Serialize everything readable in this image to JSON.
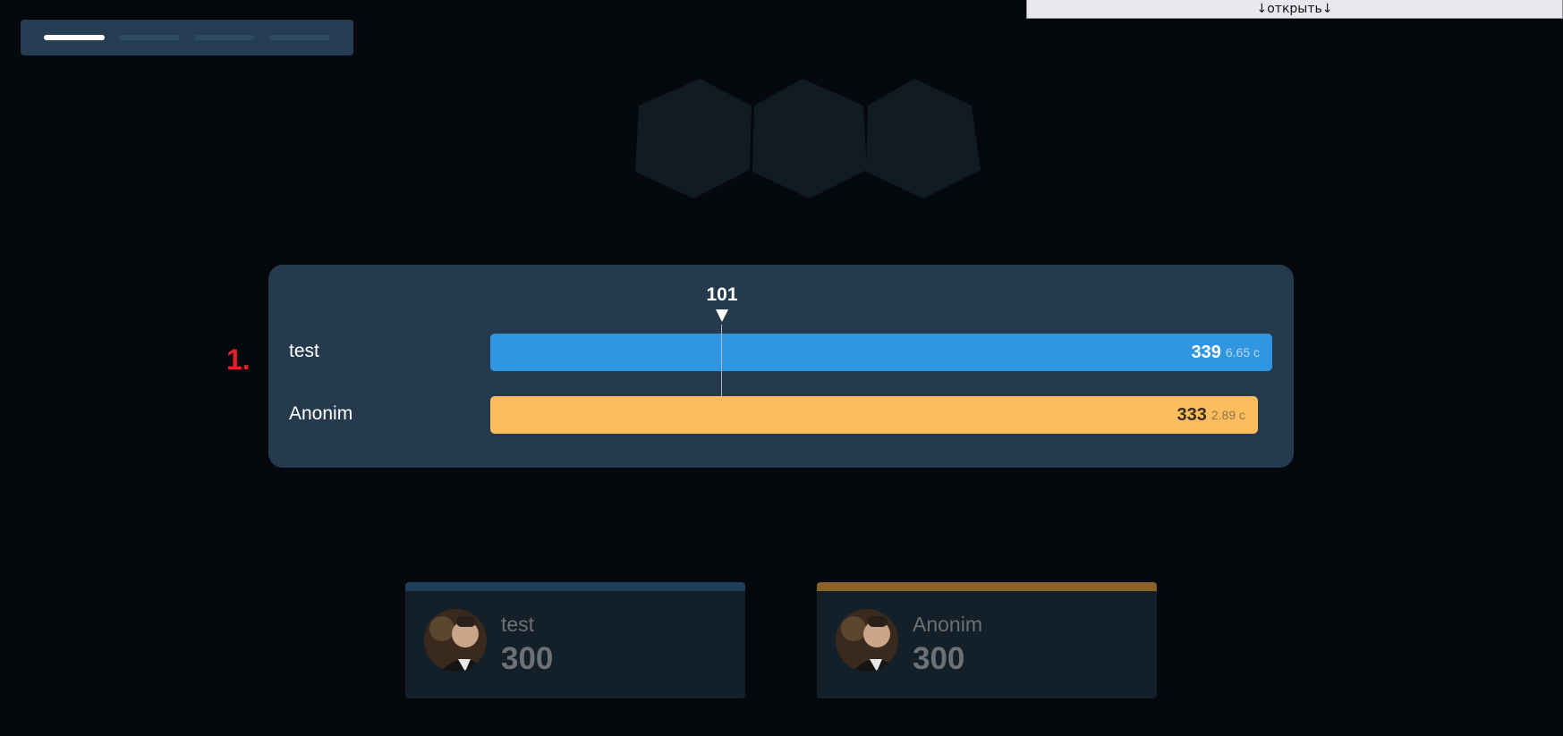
{
  "toggle": {
    "label": "↓открыть↓"
  },
  "steps": {
    "active": 1,
    "count": 4
  },
  "leaderboard": {
    "rank": "1.",
    "marker": {
      "value": "101"
    },
    "rows": [
      {
        "name": "test",
        "score": "339",
        "time": "6.65 с",
        "color": "#3196e2"
      },
      {
        "name": "Anonim",
        "score": "333",
        "time": "2.89 с",
        "color": "#fdbd5c"
      }
    ]
  },
  "players": [
    {
      "name": "test",
      "score": "300",
      "accent": "#1f3f58",
      "avatar_icon": "avatar-photo"
    },
    {
      "name": "Anonim",
      "score": "300",
      "accent": "#8b6326",
      "avatar_icon": "avatar-photo"
    }
  ],
  "colors": {
    "background": "#05090d",
    "panel": "#253a4c",
    "rank": "#e0202a"
  }
}
